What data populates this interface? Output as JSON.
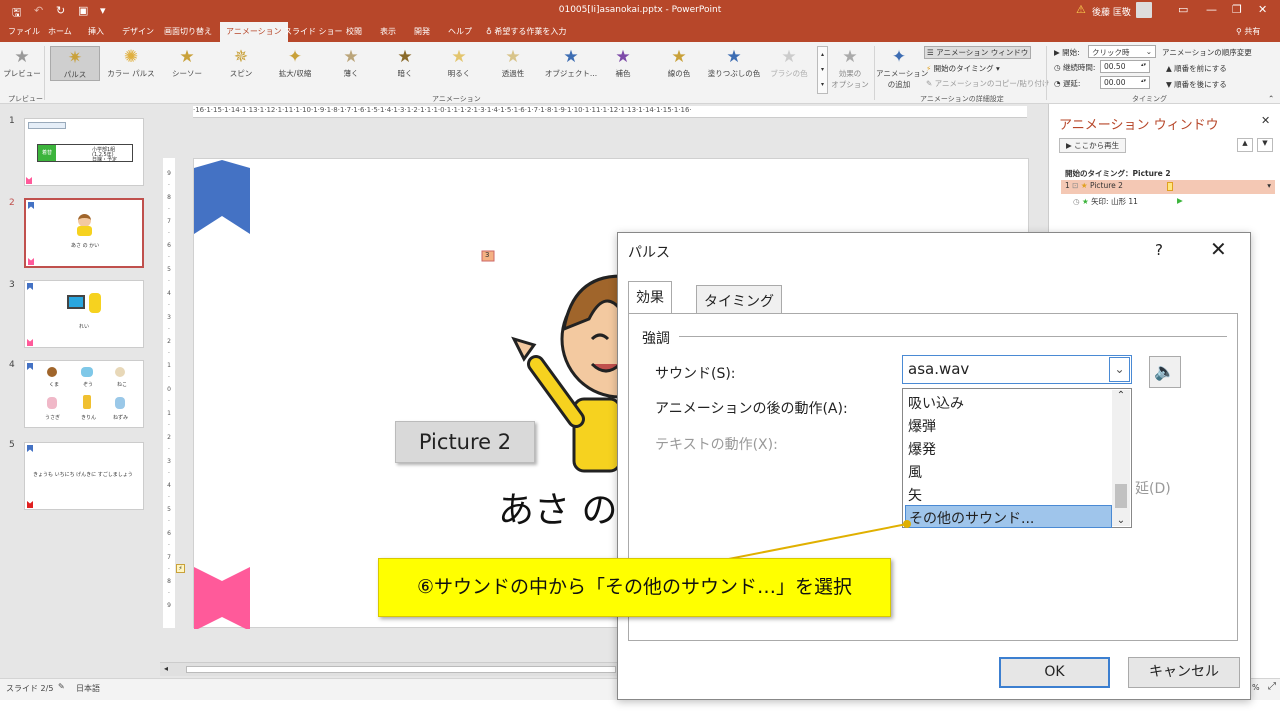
{
  "app": {
    "doc_title": "01005[Ii]asanokai.pptx  -  PowerPoint",
    "user": "後藤 匡敬",
    "share": "共有",
    "tell_me": "希望する作業を入力"
  },
  "ribbon_tabs": [
    "ファイル",
    "ホーム",
    "挿入",
    "デザイン",
    "画面切り替え",
    "アニメーション",
    "スライド ショー",
    "校閲",
    "表示",
    "開発",
    "ヘルプ"
  ],
  "active_tab_index": 5,
  "ribbon": {
    "preview_label": "プレビュー",
    "preview_group": "プレビュー",
    "animation_group": "アニメーション",
    "effects": [
      "パルス",
      "カラー パルス",
      "シーソー",
      "スピン",
      "拡大/収縮",
      "薄く",
      "暗く",
      "明るく",
      "透過性",
      "オブジェクト...",
      "補色",
      "線の色",
      "塗りつぶしの色",
      "ブラシの色"
    ],
    "effect_options": "効果の\nオプション",
    "add_animation": "アニメーション\nの追加",
    "anim_window": "アニメーション ウィンドウ",
    "trigger": "開始のタイミング",
    "anim_painter": "アニメーションのコピー/貼り付け",
    "advanced_group": "アニメーションの詳細設定",
    "start_label": "開始:",
    "start_value": "クリック時",
    "duration_label": "継続時間:",
    "duration_value": "00.50",
    "delay_label": "遅延:",
    "delay_value": "00.00",
    "reorder_label": "アニメーションの順序変更",
    "move_earlier": "順番を前にする",
    "move_later": "順番を後にする",
    "timing_group": "タイミング"
  },
  "thumbnails": [
    {
      "num": "1",
      "lines": [
        "小学部1組",
        "(1,2,5年)",
        "日課・予定"
      ],
      "box": "着替"
    },
    {
      "num": "2",
      "caption": "あさ の かい"
    },
    {
      "num": "3",
      "caption": "れい"
    },
    {
      "num": "4",
      "animals": [
        "くま",
        "ぞう",
        "ねこ",
        "うさぎ",
        "きりん",
        "ねずみ"
      ]
    },
    {
      "num": "5",
      "caption": "きょうも いちにち げんきに すごしましょう"
    }
  ],
  "ruler_text": "·16·1·15·1·14·1·13·1·12·1·11·1·10·1·9·1·8·1·7·1·6·1·5·1·4·1·3·1·2·1·1·1·0·1·1·1·2·1·3·1·4·1·5·1·6·1·7·1·8·1·9·1·10·1·11·1·12·1·13·1·14·1·15·1·16·",
  "slide": {
    "title_text": "あさ の",
    "picture_label": "Picture 2",
    "anim_tag": "3"
  },
  "anim_pane": {
    "title": "アニメーション ウィンドウ",
    "play_from": "ここから再生",
    "trigger_header": "開始のタイミング：Picture 2",
    "item1_num": "1",
    "item1": "Picture 2",
    "item2": "矢印: 山形 11"
  },
  "dialog": {
    "title": "パルス",
    "help": "?",
    "close": "✕",
    "tabs": [
      "効果",
      "タイミング"
    ],
    "group_label": "強調",
    "sound_label": "サウンド(S):",
    "sound_value": "asa.wav",
    "after_label": "アニメーションの後の動作(A):",
    "text_label": "テキストの動作(X):",
    "partial_right": "延(D)",
    "options": [
      "吸い込み",
      "爆弾",
      "爆発",
      "風",
      "矢",
      "その他のサウンド..."
    ],
    "selected_option_index": 5,
    "ok": "OK",
    "cancel": "キャンセル"
  },
  "callout": "⑥サウンドの中から「その他のサウンド…」を選択",
  "status": {
    "slide": "スライド 2/5",
    "lang": "日本語",
    "zoom": "%"
  },
  "colors": {
    "accent": "#b7472a",
    "callout": "#ffff00",
    "blue_marker": "#4472c4",
    "pink_marker": "#ff5a9a"
  }
}
